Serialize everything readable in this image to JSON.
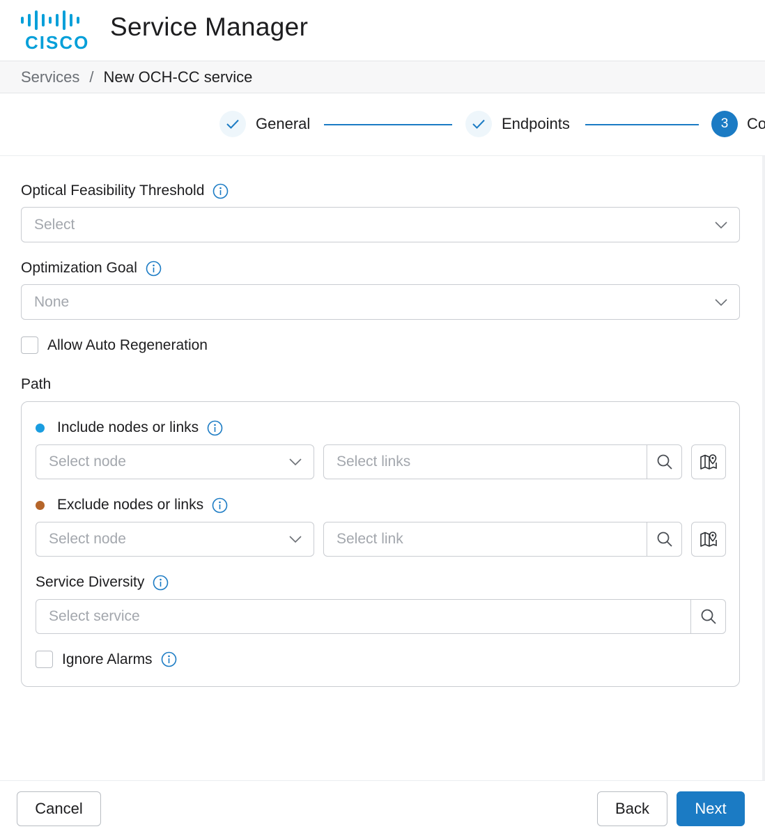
{
  "header": {
    "logo_text": "CISCO",
    "title": "Service Manager"
  },
  "breadcrumb": {
    "parent": "Services",
    "separator": "/",
    "current": "New OCH-CC service"
  },
  "stepper": {
    "steps": [
      {
        "label": "General",
        "state": "done"
      },
      {
        "label": "Endpoints",
        "state": "done"
      },
      {
        "label": "Co",
        "number": "3",
        "state": "active"
      }
    ]
  },
  "form": {
    "optical_threshold": {
      "label": "Optical Feasibility Threshold",
      "value": "Select"
    },
    "optimization_goal": {
      "label": "Optimization Goal",
      "value": "None"
    },
    "auto_regeneration": {
      "label": "Allow Auto Regeneration",
      "checked": false
    },
    "path": {
      "label": "Path",
      "include": {
        "label": "Include nodes or links",
        "dot_color": "#1a9de0",
        "node_placeholder": "Select node",
        "links_placeholder": "Select links"
      },
      "exclude": {
        "label": "Exclude nodes or links",
        "dot_color": "#b5652a",
        "node_placeholder": "Select node",
        "links_placeholder": "Select link"
      },
      "service_diversity": {
        "label": "Service Diversity",
        "placeholder": "Select service"
      },
      "ignore_alarms": {
        "label": "Ignore Alarms",
        "checked": false
      }
    }
  },
  "footer": {
    "cancel": "Cancel",
    "back": "Back",
    "next": "Next"
  },
  "colors": {
    "accent": "#1b7bc4",
    "cisco_blue": "#049fd9"
  }
}
